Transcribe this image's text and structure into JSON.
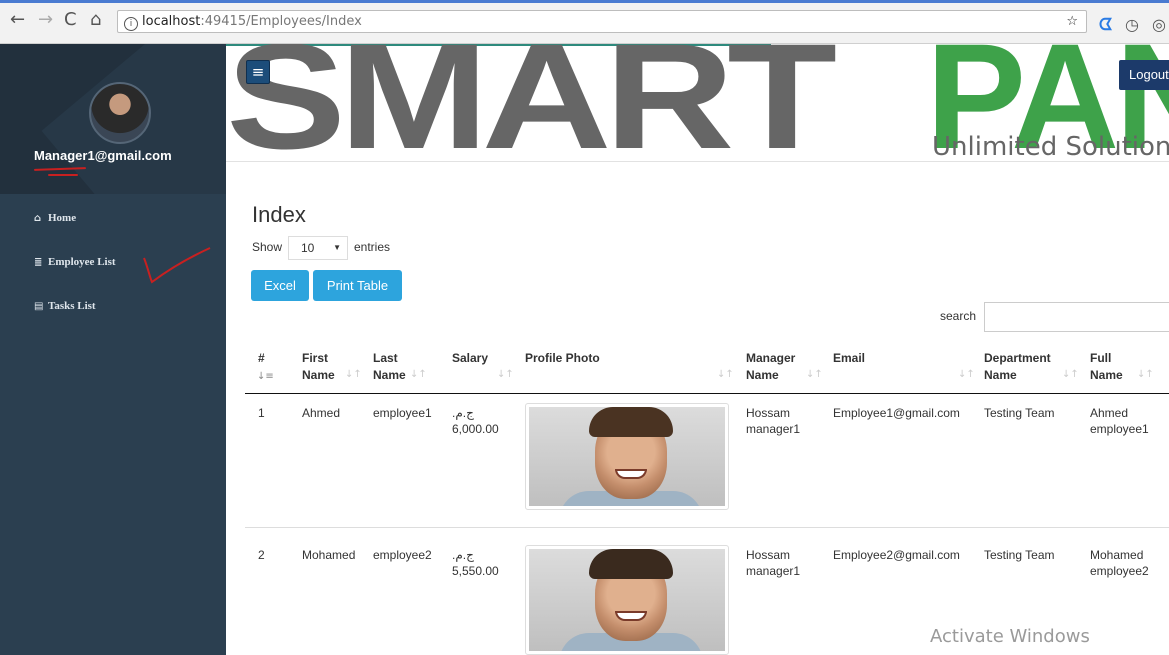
{
  "browser": {
    "back": "←",
    "forward": "→",
    "reload": "C",
    "home": "⌂",
    "url_host": "localhost",
    "url_path": ":49415/Employees/Index",
    "star": "☆",
    "ext1": "ᗧ",
    "ext2": "◷",
    "ext3": "◎"
  },
  "sidebar": {
    "user_email": "Manager1@gmail.com",
    "items": [
      {
        "icon": "⌂",
        "label": "Home"
      },
      {
        "icon": "≣",
        "label": "Employee List"
      },
      {
        "icon": "▤",
        "label": "Tasks List"
      }
    ]
  },
  "header": {
    "menu_icon": "≡",
    "logo_part1": "SMART",
    "logo_part2": "PAN",
    "logo_tagline": "Unlimited Solutions",
    "logout_label": "Logout",
    "accent_color": "#2e8a7d",
    "logo_green": "#3ea24a"
  },
  "main": {
    "title": "Index",
    "show_label": "Show",
    "page_length": "10",
    "entries_label": "entries",
    "excel_label": "Excel",
    "print_label": "Print Table",
    "search_label": "search",
    "columns": [
      {
        "l1": "#",
        "l2": ""
      },
      {
        "l1": "First",
        "l2": "Name"
      },
      {
        "l1": "Last",
        "l2": "Name"
      },
      {
        "l1": "Salary",
        "l2": ""
      },
      {
        "l1": "Profile Photo",
        "l2": ""
      },
      {
        "l1": "Manager",
        "l2": "Name"
      },
      {
        "l1": "Email",
        "l2": ""
      },
      {
        "l1": "Department",
        "l2": "Name"
      },
      {
        "l1": "Full",
        "l2": "Name"
      }
    ],
    "rows": [
      {
        "num": "1",
        "first": "Ahmed",
        "last": "employee1",
        "currency": "ج.م.‏",
        "salary": "6,000.00",
        "manager1": "Hossam",
        "manager2": "manager1",
        "email": "Employee1@gmail.com",
        "department": "Testing Team",
        "full1": "Ahmed",
        "full2": "employee1"
      },
      {
        "num": "2",
        "first": "Mohamed",
        "last": "employee2",
        "currency": "ج.م.‏",
        "salary": "5,550.00",
        "manager1": "Hossam",
        "manager2": "manager1",
        "email": "Employee2@gmail.com",
        "department": "Testing Team",
        "full1": "Mohamed",
        "full2": "employee2"
      }
    ]
  },
  "watermark": "Activate Windows"
}
